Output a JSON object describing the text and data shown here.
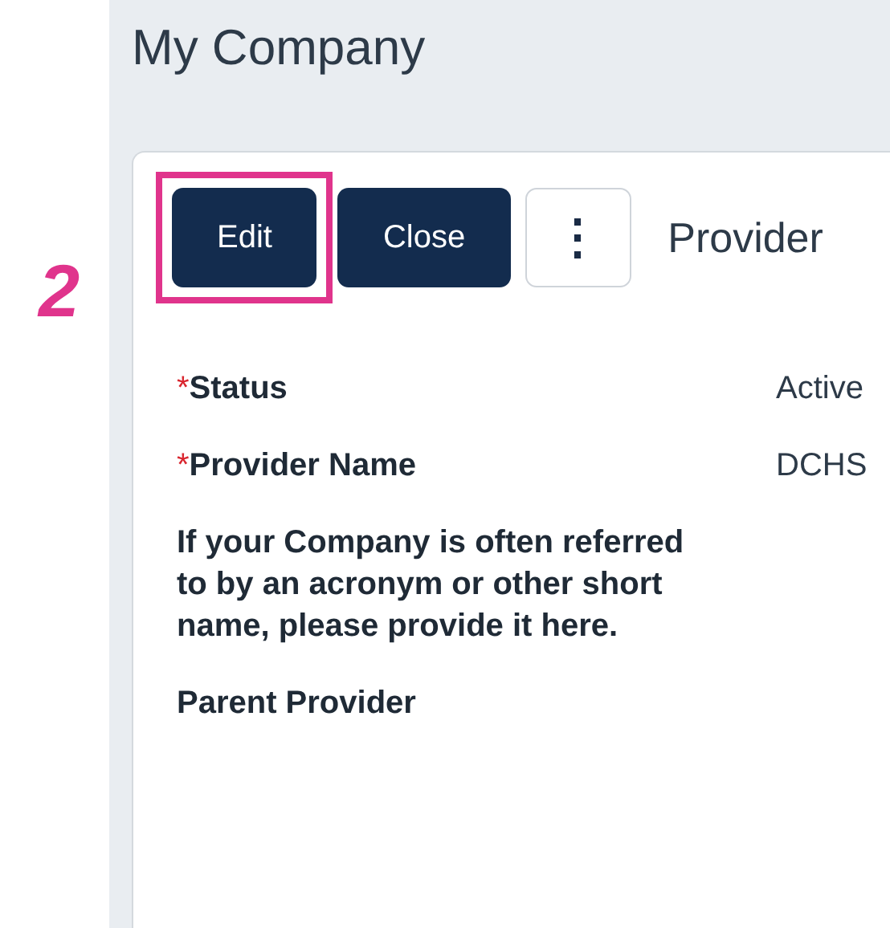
{
  "page": {
    "title": "My Company"
  },
  "callout": {
    "number": "2"
  },
  "toolbar": {
    "buttons": [
      {
        "label": "Edit",
        "highlighted": true,
        "kind": "primary"
      },
      {
        "label": "Close",
        "highlighted": false,
        "kind": "primary"
      },
      {
        "label": "⋮",
        "highlighted": false,
        "kind": "more"
      }
    ],
    "heading": "Provider"
  },
  "fields": [
    {
      "label": "Status",
      "required_mark": "*",
      "value": "Active"
    },
    {
      "label": "Provider Name",
      "required_mark": "*",
      "value": "DCHS"
    },
    {
      "label": "If your Company is often referred to by an acronym or other short name, please provide it here."
    },
    {
      "label": "Parent Provider"
    }
  ]
}
